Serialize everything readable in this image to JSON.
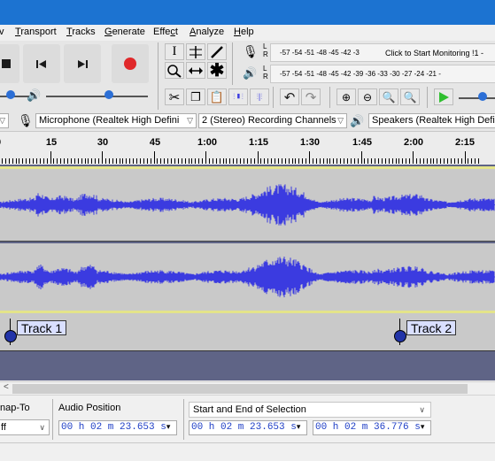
{
  "menu": {
    "items": [
      {
        "pre": "",
        "u": "V",
        "post": "iew",
        "visible": "v"
      },
      {
        "pre": "",
        "u": "T",
        "post": "ransport"
      },
      {
        "pre": "",
        "u": "T",
        "post": "racks"
      },
      {
        "pre": "",
        "u": "G",
        "post": "enerate"
      },
      {
        "pre": "Effe",
        "u": "c",
        "post": "t"
      },
      {
        "pre": "",
        "u": "A",
        "post": "nalyze"
      },
      {
        "pre": "",
        "u": "H",
        "post": "elp"
      }
    ]
  },
  "meters": {
    "record_scale": "-57 -54 -51 -48 -45 -42 -3",
    "record_prompt": "Click to Start Monitoring !1 -",
    "play_scale": "-57 -54 -51 -48 -45 -42 -39 -36 -33 -30 -27 -24 -21 -",
    "record_lr": [
      "L",
      "R"
    ],
    "play_lr": [
      "L",
      "R"
    ]
  },
  "devices": {
    "mic": "Microphone (Realtek High Defini",
    "channels": "2 (Stereo) Recording Channels",
    "speakers": "Speakers (Realtek High Defini"
  },
  "ruler": {
    "ticks": [
      "15",
      "30",
      "45",
      "1:00",
      "1:15",
      "1:30",
      "1:45",
      "2:00",
      "2:15"
    ],
    "left_tick": "0"
  },
  "labels": {
    "track1": "Track 1",
    "track2": "Track 2"
  },
  "selection_bar": {
    "snap_label": "nap-To",
    "snap_value": "ff",
    "audio_position_label": "Audio Position",
    "audio_position": "00 h 02 m 23.653 s",
    "selection_mode": "Start and End of Selection",
    "sel_start": "00 h 02 m 23.653 s",
    "sel_end": "00 h 02 m 36.776 s"
  },
  "colors": {
    "title_bar": "#1c73d1",
    "waveform": "#3b3be0",
    "track_bg": "#c9c9c9",
    "label_bg": "#d9dfff",
    "play_green": "#2fbf2f",
    "record_red": "#e0282a"
  }
}
